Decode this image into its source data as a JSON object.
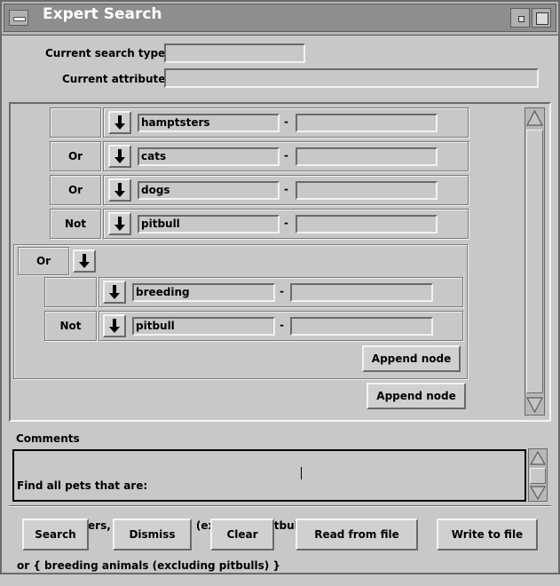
{
  "window": {
    "title": "Expert Search"
  },
  "header": {
    "search_type_label": "Current search type",
    "search_type_value": "",
    "attribute_label": "Current attribute",
    "attribute_value": ""
  },
  "query": {
    "rows": [
      {
        "operator": "",
        "value": "hamptsters",
        "range_sep": "-",
        "range_value": ""
      },
      {
        "operator": "Or",
        "value": "cats",
        "range_sep": "-",
        "range_value": ""
      },
      {
        "operator": "Or",
        "value": "dogs",
        "range_sep": "-",
        "range_value": ""
      },
      {
        "operator": "Not",
        "value": "pitbull",
        "range_sep": "-",
        "range_value": ""
      }
    ],
    "group": {
      "operator": "Or",
      "rows": [
        {
          "operator": "",
          "value": "breeding",
          "range_sep": "-",
          "range_value": ""
        },
        {
          "operator": "Not",
          "value": "pitbull",
          "range_sep": "-",
          "range_value": ""
        }
      ],
      "append_label": "Append node"
    },
    "append_label": "Append node"
  },
  "comments": {
    "label": "Comments",
    "lines": [
      "Find all pets that are:",
      "    { hampsters, cats, or dogs (excluding pitbulls) }",
      "or { breeding animals (excluding pitbulls) }"
    ]
  },
  "buttons": {
    "search": "Search",
    "dismiss": "Dismiss",
    "clear": "Clear",
    "read": "Read from file",
    "write": "Write to file"
  },
  "icons": {
    "arrow": "down-arrow-icon",
    "scroll_up": "scroll-up-icon",
    "scroll_down": "scroll-down-icon"
  }
}
